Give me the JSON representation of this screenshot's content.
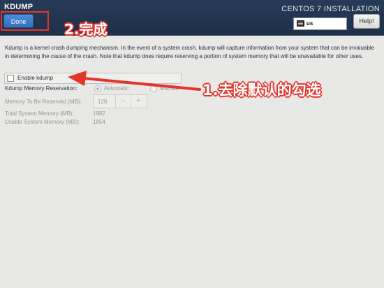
{
  "header": {
    "title": "KDUMP",
    "done_label": "Done",
    "install_title": "CENTOS 7 INSTALLATION",
    "keyboard_layout": "us",
    "help_label": "Help!"
  },
  "main": {
    "description": "Kdump is a kernel crash dumping mechanism. In the event of a system crash, kdump will capture information from your system that can be invaluable in determining the cause of the crash. Note that kdump does require reserving a portion of system memory that will be unavailable for other uses.",
    "enable_label": "Enable kdump",
    "enable_checked": false,
    "reservation_label": "Kdump Memory Reservation:",
    "reservation_options": [
      "Automatic",
      "Manual"
    ],
    "reservation_selected": "Automatic",
    "reserved_label": "Memory To Be Reserved (MB):",
    "reserved_value": "128",
    "spin_minus": "−",
    "spin_plus": "+",
    "total_label": "Total System Memory (MB):",
    "total_value": "1982",
    "usable_label": "Usable System Memory (MB):",
    "usable_value": "1854"
  },
  "annotations": {
    "step1": "1.去除默认的勾选",
    "step2": "2.完成",
    "color": "#e4342b"
  }
}
